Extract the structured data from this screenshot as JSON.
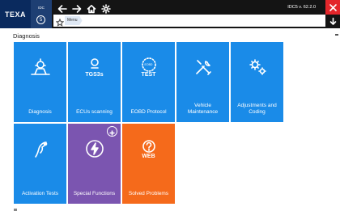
{
  "app": {
    "brand": "TEXA",
    "device_label": "IDC",
    "device_number": "5",
    "version": "IDC5 v. 62.2.0"
  },
  "nav": {
    "icons": [
      "back-arrow-icon",
      "forward-arrow-icon",
      "home-icon",
      "settings-icon"
    ]
  },
  "breadcrumb": {
    "items": [
      "Menu"
    ]
  },
  "section": {
    "title": "Diagnosis"
  },
  "tiles": [
    {
      "label": "Diagnosis",
      "icon": "car-diagnosis-icon",
      "color": "#1a8be8"
    },
    {
      "label": "ECUs scanning",
      "icon": "tgs3s-icon",
      "icon_text": "TGS3s",
      "color": "#1a8be8"
    },
    {
      "label": "EOBD Protocol",
      "icon": "eobd-test-icon",
      "icon_text": "TEST",
      "icon_small": "EOBD",
      "color": "#1a8be8"
    },
    {
      "label": "Vehicle Maintenance",
      "icon": "wrench-screwdriver-icon",
      "color": "#1a8be8"
    },
    {
      "label": "Adjustments and Coding",
      "icon": "gears-icon",
      "color": "#1a8be8"
    },
    {
      "label": "Activation Tests",
      "icon": "airbag-activation-icon",
      "color": "#1a8be8"
    },
    {
      "label": "Special Functions",
      "icon": "lightning-icon",
      "color": "#7b55b0",
      "badge": "plus-icon"
    },
    {
      "label": "Solved Problems",
      "icon": "web-help-icon",
      "icon_text": "WEB",
      "color": "#f56a1b"
    }
  ],
  "colors": {
    "topbar": "#141414",
    "brand": "#0a2a5e",
    "close": "#e3262b",
    "tile_blue": "#1a8be8",
    "tile_purple": "#7b55b0",
    "tile_orange": "#f56a1b"
  }
}
